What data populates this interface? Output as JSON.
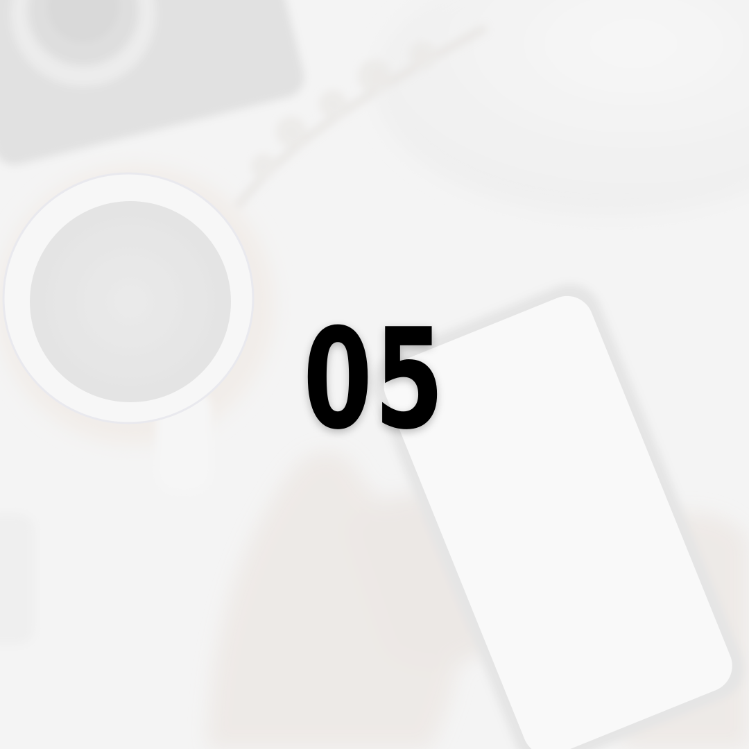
{
  "slide": {
    "number": "05"
  },
  "colors": {
    "number_text": "#000000",
    "background": "#f3f3f3"
  },
  "background_photo": {
    "icon": "coffee-and-phone-photo",
    "description_visible": false
  }
}
